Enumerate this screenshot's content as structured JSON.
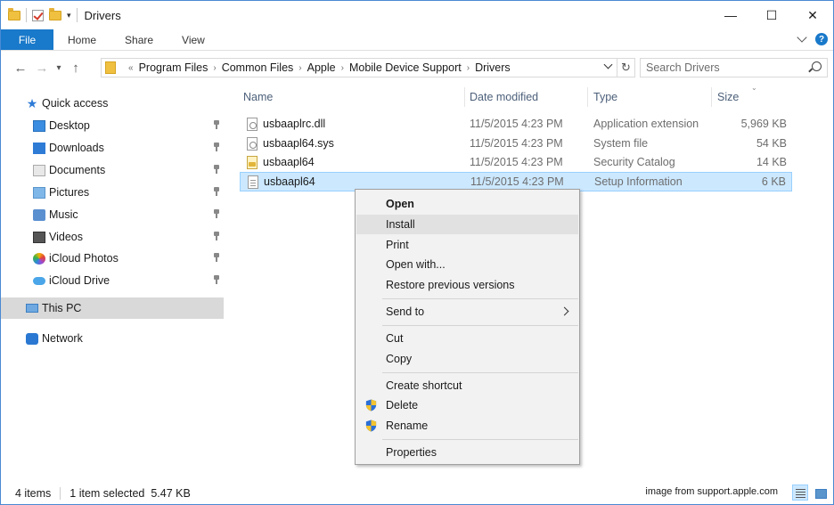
{
  "window": {
    "title": "Drivers"
  },
  "controls": {
    "minimize": "—",
    "maximize": "☐",
    "close": "✕"
  },
  "ribbon": {
    "tabs": [
      "File",
      "Home",
      "Share",
      "View"
    ],
    "help": "?",
    "accent": "#1979ca"
  },
  "nav": {
    "back": "←",
    "forward": "→",
    "recent": "▾",
    "up": "↑",
    "refresh": "↻"
  },
  "address": {
    "prefix": "«",
    "crumbs": [
      "Program Files",
      "Common Files",
      "Apple",
      "Mobile Device Support",
      "Drivers"
    ],
    "crumb_sep": "›"
  },
  "search": {
    "placeholder": "Search Drivers"
  },
  "sidebar": {
    "quick_access": "Quick access",
    "items": [
      {
        "label": "Desktop",
        "icon": "desktop-icon"
      },
      {
        "label": "Downloads",
        "icon": "downloads-icon"
      },
      {
        "label": "Documents",
        "icon": "documents-icon"
      },
      {
        "label": "Pictures",
        "icon": "pictures-icon"
      },
      {
        "label": "Music",
        "icon": "music-icon"
      },
      {
        "label": "Videos",
        "icon": "videos-icon"
      },
      {
        "label": "iCloud Photos",
        "icon": "icloud-photos-icon"
      },
      {
        "label": "iCloud Drive",
        "icon": "icloud-drive-icon"
      }
    ],
    "this_pc": "This PC",
    "network": "Network"
  },
  "columns": {
    "name": "Name",
    "date": "Date modified",
    "type": "Type",
    "size": "Size"
  },
  "files": [
    {
      "name": "usbaaplrc.dll",
      "date": "11/5/2015 4:23 PM",
      "type": "Application extension",
      "size": "5,969 KB",
      "icon": "dll-file-icon"
    },
    {
      "name": "usbaapl64.sys",
      "date": "11/5/2015 4:23 PM",
      "type": "System file",
      "size": "54 KB",
      "icon": "sys-file-icon"
    },
    {
      "name": "usbaapl64",
      "date": "11/5/2015 4:23 PM",
      "type": "Security Catalog",
      "size": "14 KB",
      "icon": "catalog-file-icon"
    },
    {
      "name": "usbaapl64",
      "date": "11/5/2015 4:23 PM",
      "type": "Setup Information",
      "size": "6 KB",
      "icon": "inf-file-icon"
    }
  ],
  "context_menu": {
    "open": "Open",
    "install": "Install",
    "print": "Print",
    "open_with": "Open with...",
    "restore": "Restore previous versions",
    "send_to": "Send to",
    "cut": "Cut",
    "copy": "Copy",
    "create_shortcut": "Create shortcut",
    "delete": "Delete",
    "rename": "Rename",
    "properties": "Properties"
  },
  "status": {
    "items": "4 items",
    "selected": "1 item selected  5.47 KB",
    "credit": "image from support.apple.com"
  }
}
